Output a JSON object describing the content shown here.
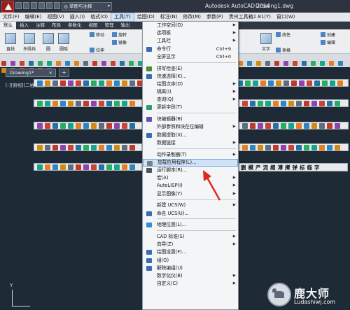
{
  "titlebar": {
    "workspace": "草图与注释",
    "app_title": "Autodesk AutoCAD 2014",
    "doc_title": "Drawing1.dwg"
  },
  "menubar": [
    {
      "label": "文件(F)"
    },
    {
      "label": "编辑(E)"
    },
    {
      "label": "视图(V)"
    },
    {
      "label": "插入(I)"
    },
    {
      "label": "格式(O)"
    },
    {
      "label": "工具(T)",
      "active": true
    },
    {
      "label": "绘图(D)"
    },
    {
      "label": "标注(N)"
    },
    {
      "label": "修改(M)"
    },
    {
      "label": "参数(P)"
    },
    {
      "label": "贵州工具箱2.81(Y)"
    },
    {
      "label": "窗口(W)"
    }
  ],
  "ribbon": {
    "tabs": [
      "默认",
      "插入",
      "注释",
      "布局",
      "参数化",
      "视图",
      "管理",
      "输出"
    ],
    "tools": {
      "line": "直线",
      "polyline": "多段线",
      "circle": "圆",
      "arc": "圆弧",
      "move": "移动",
      "rotate": "旋转",
      "mirror": "镜像",
      "stretch": "拉伸",
      "text": "文字",
      "linear": "线性",
      "table": "表格",
      "create": "创建",
      "edit": "编辑"
    }
  },
  "canvas": {
    "drawing_tab": "Drawing1*",
    "drawing_tab_close": "×",
    "new_tab": "+",
    "viewport_label": "[-][俯视][二维线框]",
    "text_toolbar": "删 模 产 流 缀 溥 撵 弹 标 临 字",
    "ucs_y": "Y"
  },
  "tools_menu": {
    "items": [
      {
        "label": "工作空间(O)",
        "arrow": true,
        "icon": ""
      },
      {
        "label": "选项板",
        "arrow": true,
        "icon": ""
      },
      {
        "label": "工具栏",
        "arrow": true,
        "icon": ""
      },
      {
        "label": "命令行",
        "shortcut": "Ctrl+9",
        "icon": "#3a6db0"
      },
      {
        "label": "全屏显示",
        "shortcut": "Ctrl+0",
        "icon": ""
      },
      {
        "sep": true
      },
      {
        "label": "拼写检查(E)",
        "icon": "#4a8c3a"
      },
      {
        "label": "快速选择(K)...",
        "icon": "#3a6db0"
      },
      {
        "label": "绘图次序(D)",
        "arrow": true,
        "icon": ""
      },
      {
        "label": "隔离(I)",
        "arrow": true,
        "icon": ""
      },
      {
        "label": "查询(Q)",
        "arrow": true,
        "icon": ""
      },
      {
        "label": "更新字段(T)",
        "icon": "#2f9c6a"
      },
      {
        "sep": true
      },
      {
        "label": "块编辑器(B)",
        "icon": "#6a4fb0"
      },
      {
        "label": "外部参照和块在位编辑",
        "arrow": true,
        "icon": ""
      },
      {
        "label": "数据提取(X)...",
        "icon": "#3a6db0"
      },
      {
        "label": "数据链接",
        "arrow": true,
        "icon": ""
      },
      {
        "sep": true
      },
      {
        "label": "动作录制器(T)",
        "arrow": true,
        "icon": ""
      },
      {
        "label": "加载应用程序(L)...",
        "highlight": true,
        "icon": "#7a7f86"
      },
      {
        "label": "运行脚本(R)...",
        "icon": "#4c5662"
      },
      {
        "label": "宏(A)",
        "arrow": true,
        "icon": ""
      },
      {
        "label": "AutoLISP(I)",
        "arrow": true,
        "icon": ""
      },
      {
        "label": "显示图像(Y)",
        "arrow": true,
        "icon": ""
      },
      {
        "sep": true
      },
      {
        "label": "新建 UCS(W)",
        "arrow": true,
        "icon": ""
      },
      {
        "label": "命名 UCS(U)...",
        "icon": "#3a6db0"
      },
      {
        "sep": true
      },
      {
        "label": "地理位置(L)...",
        "icon": "#2f8fd0"
      },
      {
        "sep": true
      },
      {
        "label": "CAD 标准(S)",
        "arrow": true,
        "icon": ""
      },
      {
        "label": "向导(Z)",
        "arrow": true,
        "icon": ""
      },
      {
        "label": "绘图设置(F)...",
        "icon": "#3a6db0"
      },
      {
        "label": "组(G)",
        "icon": "#3a6db0"
      },
      {
        "label": "解除编组(U)",
        "icon": "#3a6db0"
      },
      {
        "label": "数字化仪(B)",
        "arrow": true,
        "icon": ""
      },
      {
        "label": "自定义(C)",
        "arrow": true,
        "icon": ""
      }
    ]
  },
  "watermark": {
    "name": "鹿大师",
    "url": "Ludashiwj.com"
  },
  "colors": {
    "accent": "#6a9fd6",
    "highlight": "#cfe3f8",
    "arrow": "#e0281e",
    "canvas": "#1e2a36"
  }
}
